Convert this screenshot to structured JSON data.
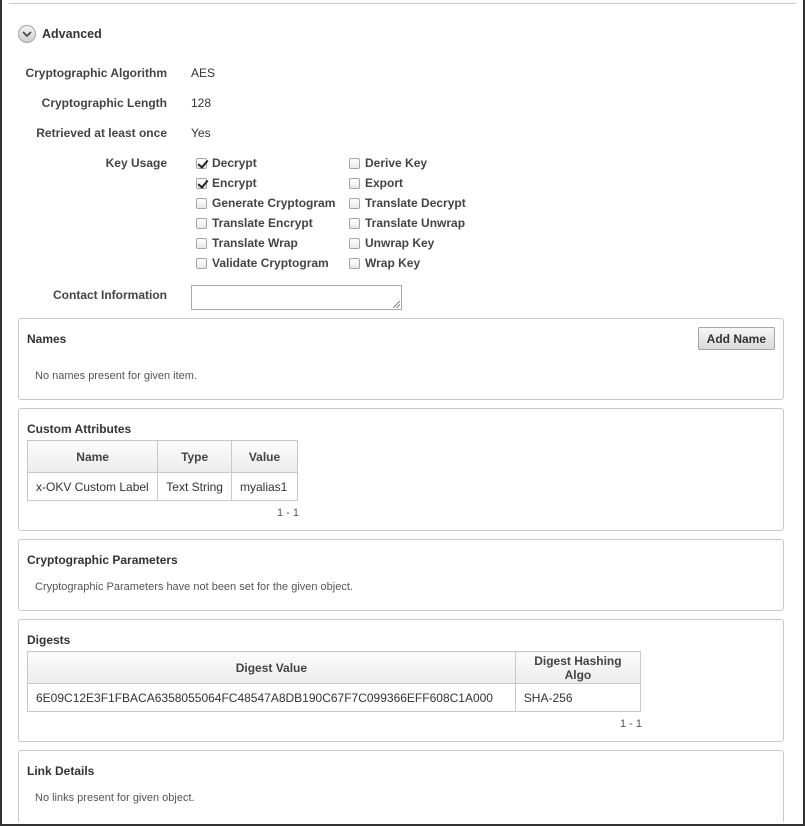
{
  "advanced": {
    "label": "Advanced",
    "icon": "chevron-down-icon"
  },
  "fields": {
    "algorithm": {
      "label": "Cryptographic Algorithm",
      "value": "AES"
    },
    "length": {
      "label": "Cryptographic Length",
      "value": "128"
    },
    "retrieved": {
      "label": "Retrieved at least once",
      "value": "Yes"
    },
    "key_usage_label": "Key Usage",
    "contact_label": "Contact Information",
    "contact_value": ""
  },
  "key_usage": {
    "col1": [
      {
        "label": "Decrypt",
        "checked": true
      },
      {
        "label": "Encrypt",
        "checked": true
      },
      {
        "label": "Generate Cryptogram",
        "checked": false
      },
      {
        "label": "Translate Encrypt",
        "checked": false
      },
      {
        "label": "Translate Wrap",
        "checked": false
      },
      {
        "label": "Validate Cryptogram",
        "checked": false
      }
    ],
    "col2": [
      {
        "label": "Derive Key",
        "checked": false
      },
      {
        "label": "Export",
        "checked": false
      },
      {
        "label": "Translate Decrypt",
        "checked": false
      },
      {
        "label": "Translate Unwrap",
        "checked": false
      },
      {
        "label": "Unwrap Key",
        "checked": false
      },
      {
        "label": "Wrap Key",
        "checked": false
      }
    ]
  },
  "names": {
    "title": "Names",
    "button": "Add Name",
    "empty": "No names present for given item."
  },
  "custom_attributes": {
    "title": "Custom Attributes",
    "columns": [
      "Name",
      "Type",
      "Value"
    ],
    "rows": [
      [
        "x-OKV Custom Label",
        "Text String",
        "myalias1"
      ]
    ],
    "pager": "1 - 1"
  },
  "crypto_params": {
    "title": "Cryptographic Parameters",
    "empty": "Cryptographic Parameters have not been set for the given object."
  },
  "digests": {
    "title": "Digests",
    "columns": [
      "Digest Value",
      "Digest Hashing Algo"
    ],
    "rows": [
      [
        "6E09C12E3F1FBACA6358055064FC48547A8DB190C67F7C099366EFF608C1A000",
        "SHA-256"
      ]
    ],
    "pager": "1 - 1"
  },
  "link_details": {
    "title": "Link Details",
    "empty": "No links present for given object."
  }
}
